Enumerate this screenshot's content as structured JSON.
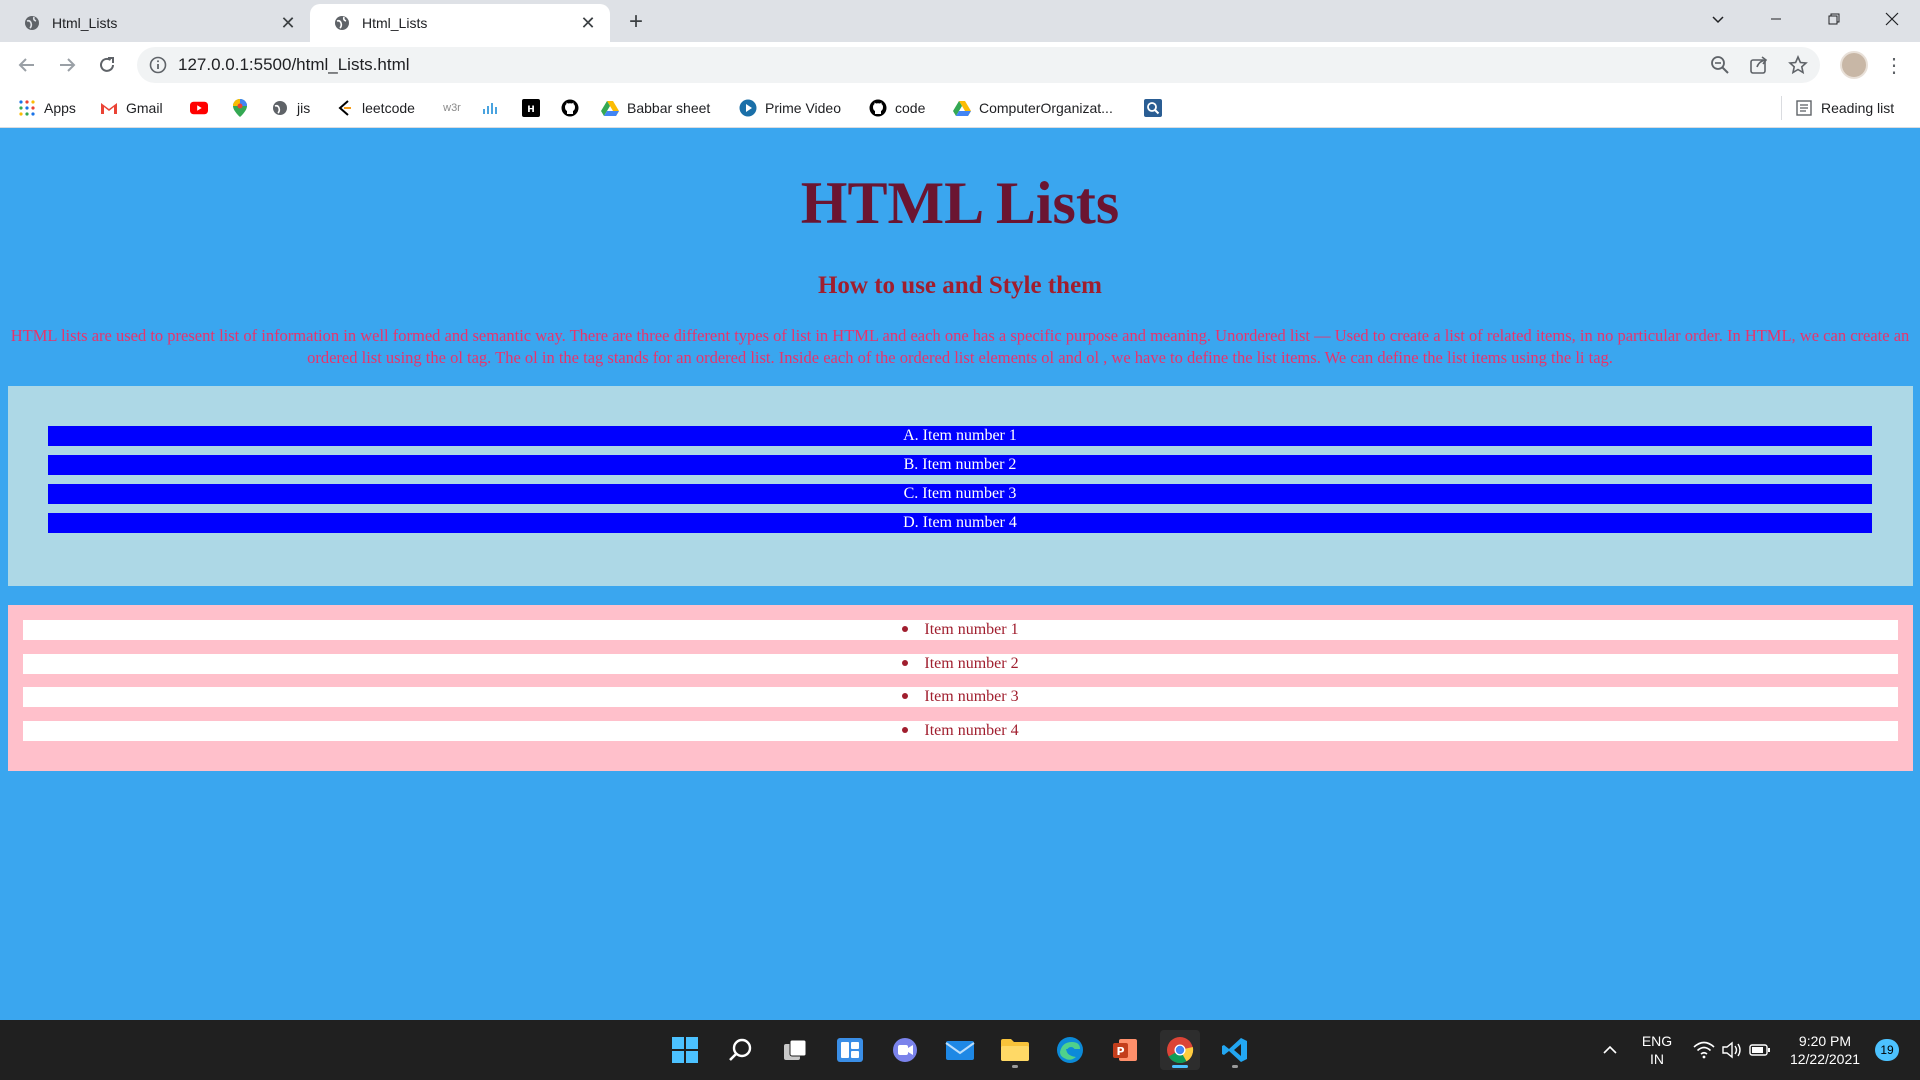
{
  "browser": {
    "tabs": [
      {
        "title": "Html_Lists",
        "active": false
      },
      {
        "title": "Html_Lists",
        "active": true
      }
    ],
    "new_tab_label": "+",
    "url": "127.0.0.1:5500/html_Lists.html",
    "bookmarks": [
      {
        "label": "Apps",
        "icon": "apps-grid-icon"
      },
      {
        "label": "Gmail",
        "icon": "gmail-icon"
      },
      {
        "label": "",
        "icon": "youtube-icon"
      },
      {
        "label": "",
        "icon": "maps-pin-icon"
      },
      {
        "label": "jis",
        "icon": "globe-icon"
      },
      {
        "label": "leetcode",
        "icon": "leetcode-icon"
      },
      {
        "label": "",
        "icon": "w3schools-icon"
      },
      {
        "label": "",
        "icon": "chart-icon"
      },
      {
        "label": "",
        "icon": "hackerrank-icon"
      },
      {
        "label": "",
        "icon": "github-icon"
      },
      {
        "label": "Babbar sheet",
        "icon": "google-drive-icon"
      },
      {
        "label": "Prime Video",
        "icon": "prime-video-icon"
      },
      {
        "label": "code",
        "icon": "github-icon"
      },
      {
        "label": "ComputerOrganizat...",
        "icon": "google-drive-icon"
      },
      {
        "label": "",
        "icon": "search-box-icon"
      }
    ],
    "reading_list_label": "Reading list",
    "w3_text": "w3r"
  },
  "page": {
    "title": "HTML Lists",
    "subtitle": "How to use and Style them",
    "intro": "HTML lists are used to present list of information in well formed and semantic way. There are three different types of list in HTML and each one has a specific purpose and meaning. Unordered list — Used to create a list of related items, in no particular order. In HTML, we can create an ordered list using the ol tag. The ol in the tag stands for an ordered list. Inside each of the ordered list elements ol and ol , we have to define the list items. We can define the list items using the li tag.",
    "ordered_list": [
      "A. Item number 1",
      "B. Item number 2",
      "C. Item number 3",
      "D. Item number 4"
    ],
    "unordered_list": [
      "Item number 1",
      "Item number 2",
      "Item number 3",
      "Item number 4"
    ]
  },
  "taskbar": {
    "language_top": "ENG",
    "language_bottom": "IN",
    "time": "9:20 PM",
    "date": "12/22/2021",
    "notifications": "19"
  },
  "colors": {
    "page_bg": "#3aa6ef",
    "title": "#6b1531",
    "subtitle": "#a01e2e",
    "intro_text": "#e8336c",
    "ol_box": "#add8e6",
    "ol_item": "#0000ff",
    "ul_box": "#ffc0cb"
  }
}
